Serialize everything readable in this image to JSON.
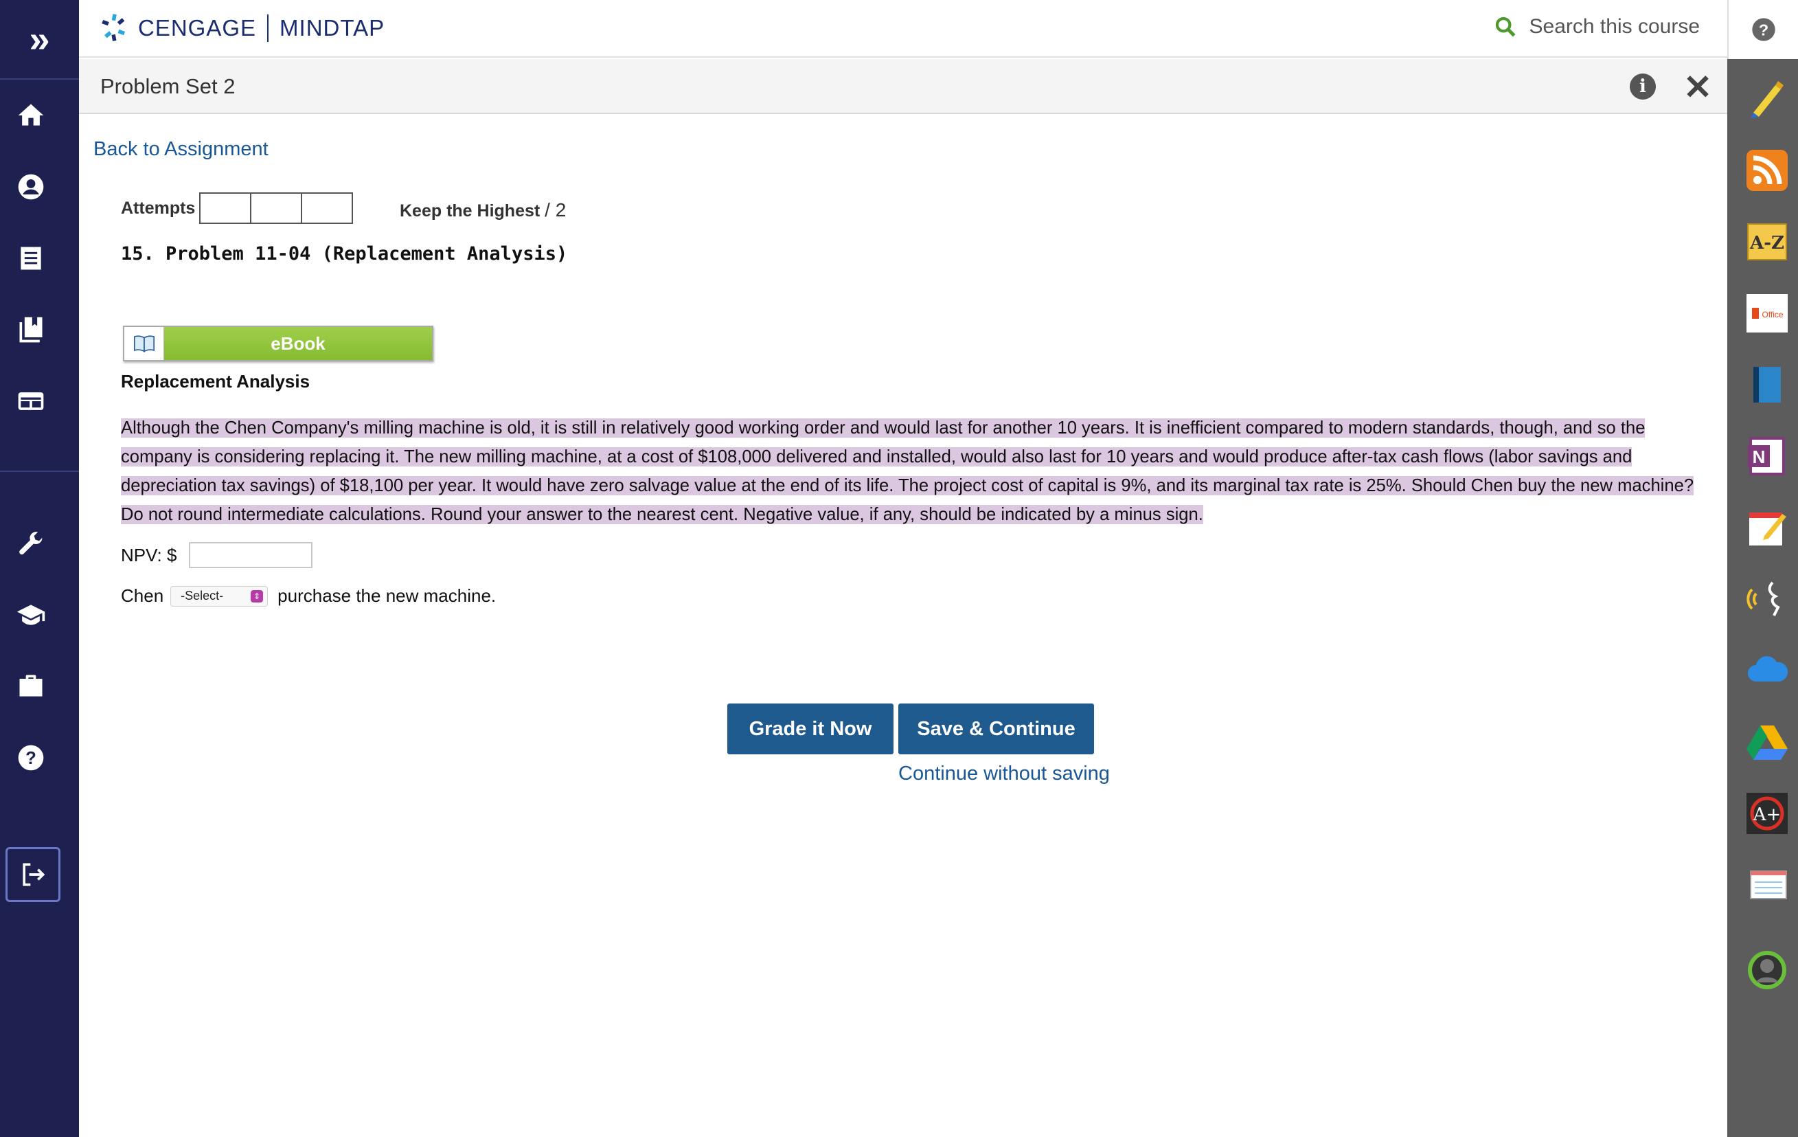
{
  "header": {
    "brand": "CENGAGE",
    "product": "MINDTAP",
    "search_placeholder": "Search this course"
  },
  "titlebar": {
    "title": "Problem Set 2"
  },
  "back_link": "Back to Assignment",
  "attempts": {
    "label": "Attempts",
    "keep_label": "Keep the Highest",
    "score": "/ 2",
    "boxes": 3
  },
  "problem": {
    "title": "15.  Problem 11-04 (Replacement Analysis)",
    "ebook_label": "eBook",
    "subhead": "Replacement Analysis",
    "text": "Although the Chen Company's milling machine is old, it is still in relatively good working order and would last for another 10 years. It is inefficient compared to modern standards, though, and so the company is considering replacing it. The new milling machine, at a cost of $108,000 delivered and installed, would also last for 10 years and would produce after-tax cash flows (labor savings and depreciation tax savings) of $18,100 per year. It would have zero salvage value at the end of its life. The project cost of capital is 9%, and its marginal tax rate is 25%. Should Chen buy the new machine? Do not round intermediate calculations. Round your answer to the nearest cent. Negative value, if any, should be indicated by a minus sign.",
    "npv_label": "NPV: $",
    "npv_value": "",
    "chen_prefix": "Chen",
    "select_value": "-Select-",
    "chen_suffix": "purchase the new machine."
  },
  "actions": {
    "grade": "Grade it Now",
    "save": "Save & Continue",
    "continue": "Continue without saving"
  },
  "left_nav": [
    "expand-icon",
    "home-icon",
    "account-icon",
    "notebook-icon",
    "library-icon",
    "card-icon",
    "wrench-icon",
    "graduation-icon",
    "briefcase-icon",
    "help-icon",
    "signout-icon"
  ],
  "right_rail": [
    "help-icon",
    "highlighter-icon",
    "rss-icon",
    "dictionary-icon",
    "office-icon",
    "book-icon",
    "onenote-icon",
    "notes-icon",
    "readspeaker-icon",
    "cloud-icon",
    "drive-icon",
    "aplus-icon",
    "flashcards-icon",
    "profile-icon"
  ],
  "colors": {
    "nav": "#1e2150",
    "accent": "#1f5a8f",
    "highlight": "#dcc7e1",
    "ebook": "#8cc63f"
  }
}
